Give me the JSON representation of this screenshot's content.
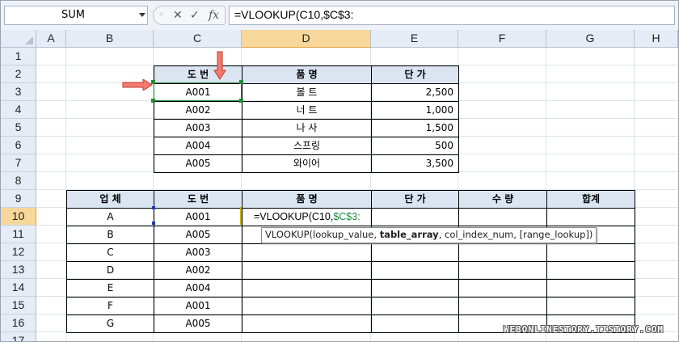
{
  "formula_bar": {
    "name_box": "SUM",
    "cancel_icon": "✕",
    "enter_icon": "✓",
    "fx_icon": "fx",
    "formula": "=VLOOKUP(C10,$C$3:"
  },
  "columns": [
    "A",
    "B",
    "C",
    "D",
    "E",
    "F",
    "G",
    "H"
  ],
  "rows": [
    "1",
    "2",
    "3",
    "4",
    "5",
    "6",
    "7",
    "8",
    "9",
    "10",
    "11",
    "12",
    "13",
    "14",
    "15",
    "16",
    "17"
  ],
  "table1": {
    "headers": [
      "도  번",
      "품  명",
      "단  가"
    ],
    "rows": [
      [
        "A001",
        "볼  트",
        "2,500"
      ],
      [
        "A002",
        "너  트",
        "1,000"
      ],
      [
        "A003",
        "나  사",
        "1,500"
      ],
      [
        "A004",
        "스프링",
        "500"
      ],
      [
        "A005",
        "와이어",
        "3,500"
      ]
    ]
  },
  "table2": {
    "headers": [
      "업  체",
      "도  번",
      "품  명",
      "단  가",
      "수  량",
      "합계"
    ],
    "rows": [
      [
        "A",
        "A001"
      ],
      [
        "B",
        "A005"
      ],
      [
        "C",
        "A003"
      ],
      [
        "D",
        "A002"
      ],
      [
        "E",
        "A004"
      ],
      [
        "F",
        "A001"
      ],
      [
        "G",
        "A005"
      ]
    ]
  },
  "editing_cell": {
    "prefix": "=VLOOKUP(C10,",
    "ref": "$C$3:"
  },
  "tooltip": {
    "prefix": "VLOOKUP(lookup_value, ",
    "bold": "table_array",
    "suffix": ", col_index_num, [range_lookup])"
  },
  "watermark": "WEBONLINESTORY.TISTORY.COM",
  "colors": {
    "header_fill": "#dbe5f1",
    "selected_header": "#f7d79a",
    "arrow": "#e8453c",
    "range_green": "#1e8a3c"
  }
}
